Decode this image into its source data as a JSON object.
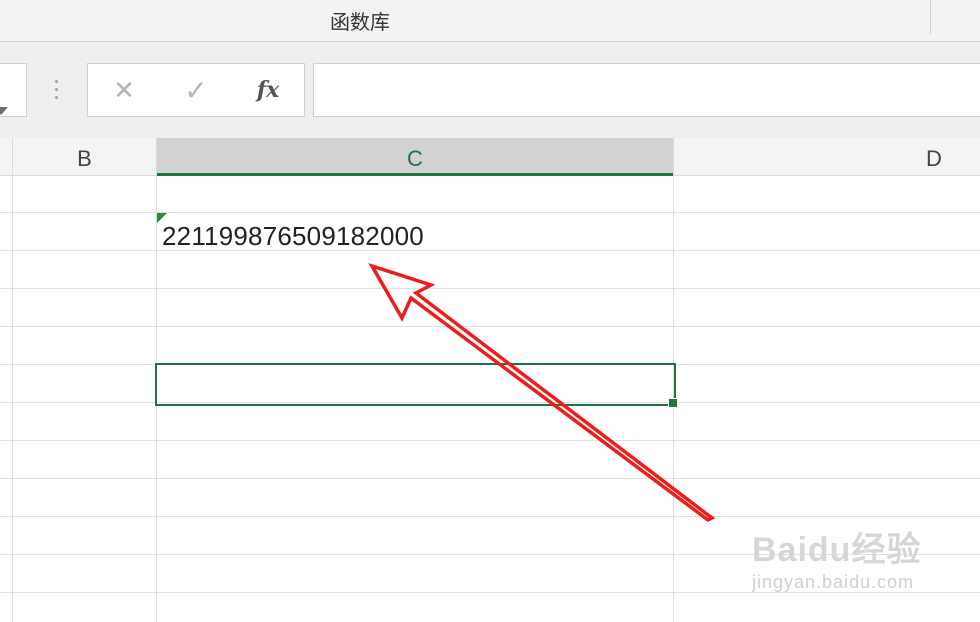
{
  "ribbon": {
    "group_label": "函数库"
  },
  "formula_bar": {
    "cancel_glyph": "✕",
    "enter_glyph": "✓",
    "fx_label": "fx",
    "value": ""
  },
  "columns": [
    {
      "label": "B"
    },
    {
      "label": "C",
      "selected": true
    },
    {
      "label": "D"
    }
  ],
  "cells": {
    "C2": "22119987650918​2000"
  },
  "watermark": {
    "brand": "Baidu经验",
    "url": "jingyan.baidu.com"
  },
  "colors": {
    "accent": "#217346",
    "annotation_arrow": "#ee1c1c"
  }
}
